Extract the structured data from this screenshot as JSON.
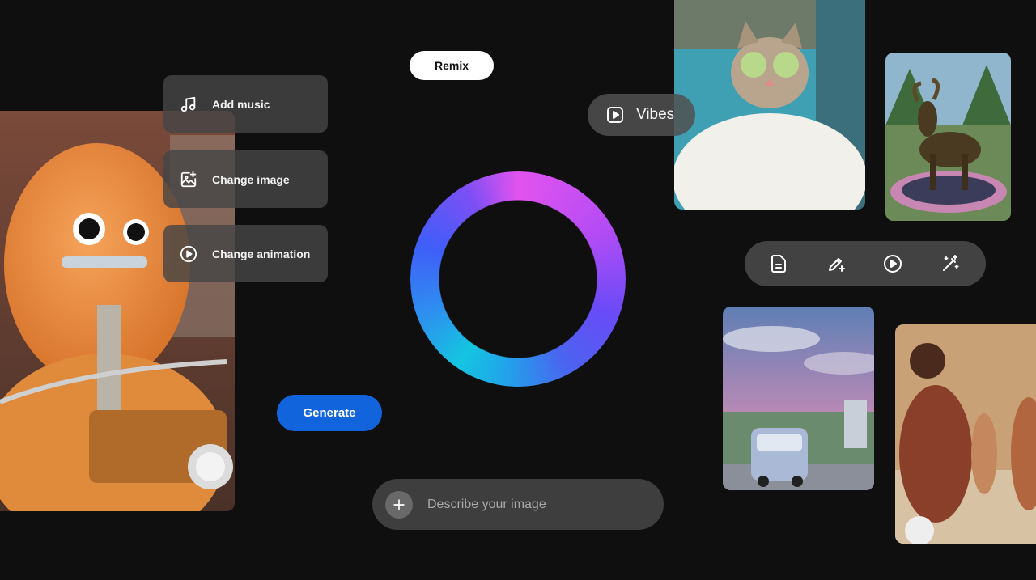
{
  "menu": {
    "items": [
      {
        "label": "Add music",
        "icon": "music-note-icon"
      },
      {
        "label": "Change image",
        "icon": "image-sparkle-icon"
      },
      {
        "label": "Change animation",
        "icon": "play-circle-icon"
      }
    ]
  },
  "remix": {
    "label": "Remix"
  },
  "vibes": {
    "label": "Vibes",
    "icon": "play-square-icon"
  },
  "generate": {
    "label": "Generate"
  },
  "toolbar": {
    "tools": [
      "document-icon",
      "edit-sparkle-icon",
      "play-circle-icon",
      "magic-wand-icon"
    ]
  },
  "prompt": {
    "placeholder": "Describe your image",
    "value": ""
  },
  "colors": {
    "background": "#0f0f0f",
    "accent": "#1264dd",
    "ring_gradient": [
      "#e253ee",
      "#6a4bf7",
      "#14c5e0",
      "#3f5ef8"
    ]
  }
}
